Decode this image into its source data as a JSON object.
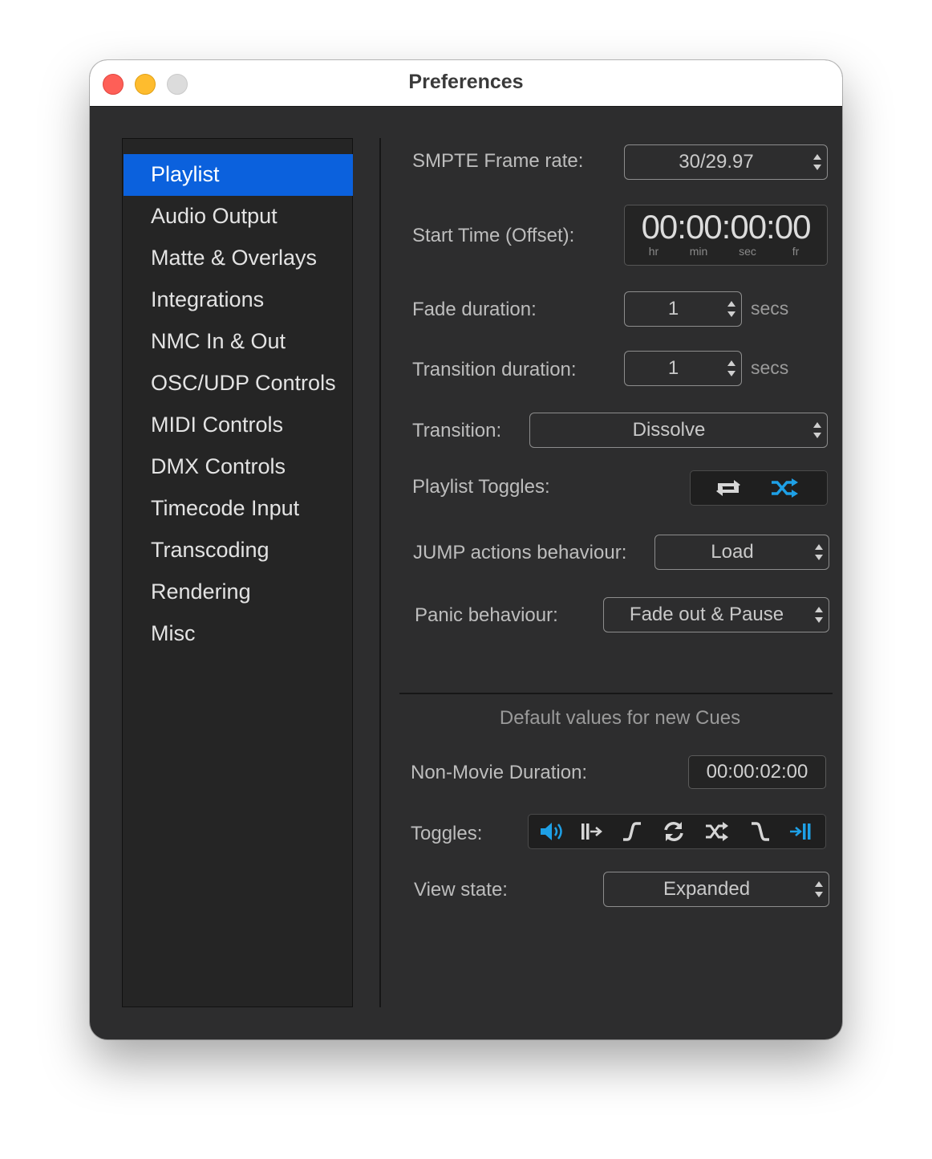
{
  "window": {
    "title": "Preferences"
  },
  "sidebar": {
    "items": [
      {
        "label": "Playlist",
        "selected": true
      },
      {
        "label": "Audio Output"
      },
      {
        "label": "Matte & Overlays"
      },
      {
        "label": "Integrations"
      },
      {
        "label": "NMC In & Out"
      },
      {
        "label": "OSC/UDP Controls"
      },
      {
        "label": "MIDI Controls"
      },
      {
        "label": "DMX Controls"
      },
      {
        "label": "Timecode Input"
      },
      {
        "label": "Transcoding"
      },
      {
        "label": "Rendering"
      },
      {
        "label": "Misc"
      }
    ]
  },
  "playlist": {
    "smpte_frame_rate": {
      "label": "SMPTE Frame rate:",
      "value": "30/29.97"
    },
    "start_time": {
      "label": "Start Time (Offset):",
      "value": "00:00:00:00",
      "units": {
        "hr": "hr",
        "min": "min",
        "sec": "sec",
        "fr": "fr"
      }
    },
    "fade_duration": {
      "label": "Fade duration:",
      "value": "1",
      "unit": "secs"
    },
    "transition_duration": {
      "label": "Transition duration:",
      "value": "1",
      "unit": "secs"
    },
    "transition": {
      "label": "Transition:",
      "value": "Dissolve"
    },
    "playlist_toggles": {
      "label": "Playlist Toggles:",
      "items": [
        {
          "icon": "repeat-icon",
          "active": false
        },
        {
          "icon": "shuffle-icon",
          "active": true
        }
      ]
    },
    "jump_actions": {
      "label": "JUMP actions behaviour:",
      "value": "Load"
    },
    "panic": {
      "label": "Panic behaviour:",
      "value": "Fade out & Pause"
    }
  },
  "defaults": {
    "heading": "Default values for new Cues",
    "non_movie_duration": {
      "label": "Non-Movie Duration:",
      "value": "00:00:02:00"
    },
    "toggles": {
      "label": "Toggles:",
      "items": [
        {
          "icon": "speaker-icon",
          "active": true
        },
        {
          "icon": "play-next-icon",
          "active": false
        },
        {
          "icon": "fade-in-icon",
          "active": false
        },
        {
          "icon": "loop-icon",
          "active": false
        },
        {
          "icon": "shuffle-icon",
          "active": false
        },
        {
          "icon": "fade-out-icon",
          "active": false
        },
        {
          "icon": "skip-to-end-icon",
          "active": true
        }
      ]
    },
    "view_state": {
      "label": "View state:",
      "value": "Expanded"
    }
  },
  "colors": {
    "accent": "#0b61dd",
    "toggle_active": "#1ea0e6",
    "toggle_inactive": "#d6d6d6"
  }
}
